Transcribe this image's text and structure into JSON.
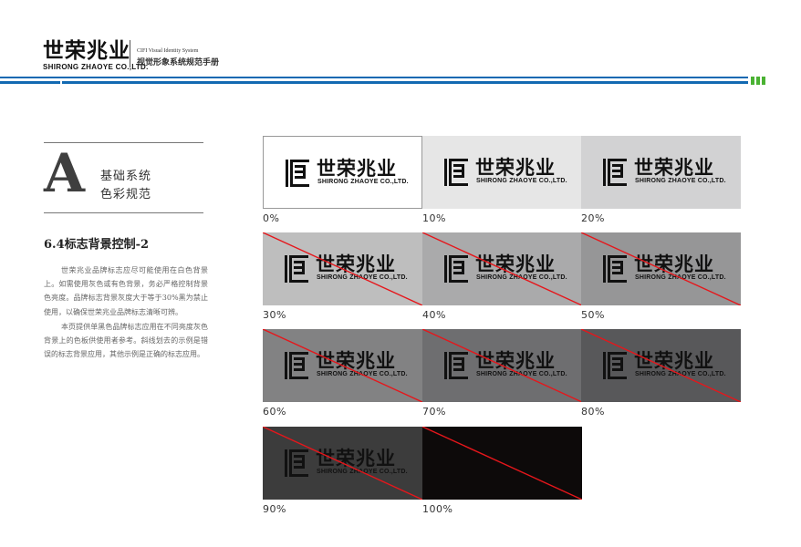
{
  "header": {
    "logo_cn": "世荣兆业",
    "logo_en": "SHIRONG ZHAOYE CO.,LTD.",
    "subtitle_en": "CIFI Visual Identity System",
    "subtitle_cn": "视觉形象系统规范手册"
  },
  "section": {
    "letter": "A",
    "name_line1": "基础系统",
    "name_line2": "色彩规范"
  },
  "page_title": "6.4标志背景控制-2",
  "paragraphs": [
    "世荣兆业品牌标志应尽可能使用在白色背景上。如需使用灰色或有色背景，务必严格控制背景色亮度。品牌标志背景灰度大于等于30%黑为禁止使用，以确保世荣兆业品牌标志清晰可辨。",
    "本页提供单黑色品牌标志应用在不同亮度灰色背景上的色板供使用者参考。斜线划去的示例是错误的标志背景应用，其他示例是正确的标志应用。"
  ],
  "logo": {
    "cn": "世荣兆业",
    "en": "SHIRONG ZHAOYE CO.,LTD."
  },
  "swatches": [
    {
      "label": "0%",
      "bg": "#ffffff",
      "crossed": false,
      "show_logo": true
    },
    {
      "label": "10%",
      "bg": "#e6e6e6",
      "crossed": false,
      "show_logo": true
    },
    {
      "label": "20%",
      "bg": "#d2d2d3",
      "crossed": false,
      "show_logo": true
    },
    {
      "label": "30%",
      "bg": "#bebebe",
      "crossed": true,
      "show_logo": true
    },
    {
      "label": "40%",
      "bg": "#aaaaab",
      "crossed": true,
      "show_logo": true
    },
    {
      "label": "50%",
      "bg": "#969697",
      "crossed": true,
      "show_logo": true
    },
    {
      "label": "60%",
      "bg": "#828283",
      "crossed": true,
      "show_logo": true
    },
    {
      "label": "70%",
      "bg": "#6e6e70",
      "crossed": true,
      "show_logo": true
    },
    {
      "label": "80%",
      "bg": "#58585a",
      "crossed": true,
      "show_logo": true
    },
    {
      "label": "90%",
      "bg": "#3c3c3c",
      "crossed": true,
      "show_logo": true
    },
    {
      "label": "100%",
      "bg": "#0d0a0a",
      "crossed": true,
      "show_logo": false
    }
  ],
  "colors": {
    "band_blue": "#1269b2",
    "accent_green": "#4ab233",
    "strike_red": "#e6161b"
  }
}
